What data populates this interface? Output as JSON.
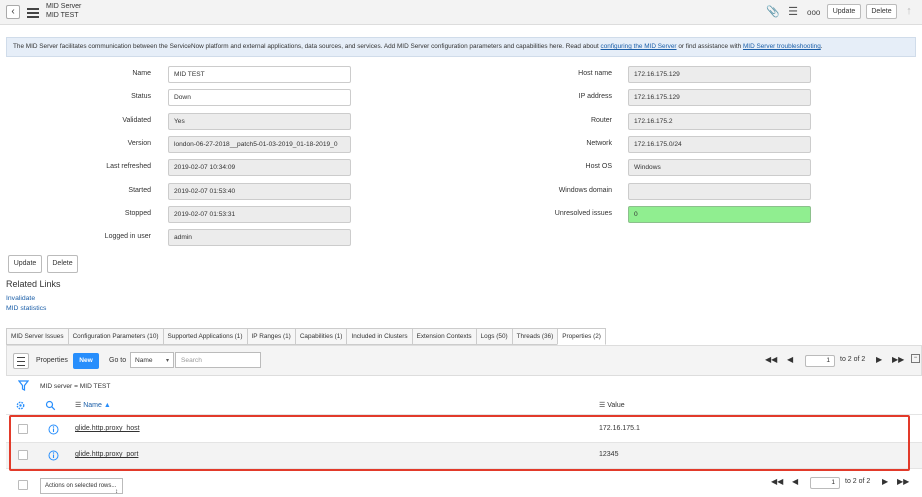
{
  "header": {
    "title": "MID Server",
    "subtitle": "MID TEST",
    "update_label": "Update",
    "delete_label": "Delete",
    "more_label": "ooo"
  },
  "info": {
    "text_before": "The MID Server facilitates communication between the ServiceNow platform and external applications, data sources, and services. Add MID Server configuration parameters and capabilities here. Read about ",
    "link1": "configuring the MID Server",
    "text_middle": " or find assistance with ",
    "link2": "MID Server troubleshooting",
    "text_after": "."
  },
  "form_left": [
    {
      "label": "Name",
      "value": "MID TEST",
      "style": "wr"
    },
    {
      "label": "Status",
      "value": "Down",
      "style": "wr"
    },
    {
      "label": "Validated",
      "value": "Yes",
      "style": "ro"
    },
    {
      "label": "Version",
      "value": "london-06-27-2018__patch5-01-03-2019_01-18-2019_0",
      "style": "ro"
    },
    {
      "label": "Last refreshed",
      "value": "2019-02-07 10:34:09",
      "style": "ro"
    },
    {
      "label": "Started",
      "value": "2019-02-07 01:53:40",
      "style": "ro"
    },
    {
      "label": "Stopped",
      "value": "2019-02-07 01:53:31",
      "style": "ro"
    },
    {
      "label": "Logged in user",
      "value": "admin",
      "style": "ro"
    }
  ],
  "form_right": [
    {
      "label": "Host name",
      "value": "172.16.175.129",
      "style": "ro"
    },
    {
      "label": "IP address",
      "value": "172.16.175.129",
      "style": "ro"
    },
    {
      "label": "Router",
      "value": "172.16.175.2",
      "style": "ro"
    },
    {
      "label": "Network",
      "value": "172.16.175.0/24",
      "style": "ro"
    },
    {
      "label": "Host OS",
      "value": "Windows",
      "style": "ro"
    },
    {
      "label": "Windows domain",
      "value": "",
      "style": "ro"
    },
    {
      "label": "Unresolved issues",
      "value": "0",
      "style": "ok"
    }
  ],
  "form_buttons": {
    "update": "Update",
    "delete": "Delete"
  },
  "related": {
    "title": "Related Links",
    "links": [
      "Invalidate",
      "MID statistics"
    ]
  },
  "tabs": [
    "MID Server Issues",
    "Configuration Parameters (10)",
    "Supported Applications (1)",
    "IP Ranges (1)",
    "Capabilities (1)",
    "Included in Clusters",
    "Extension Contexts",
    "Logs (50)",
    "Threads (36)",
    "Properties (2)"
  ],
  "active_tab": "Properties (2)",
  "list": {
    "title": "Properties",
    "new_label": "New",
    "goto_label": "Go to",
    "goto_field": "Name",
    "search_placeholder": "Search",
    "page_value": "1",
    "page_total": "to 2 of 2",
    "page_total_bottom": "to 2 of 2",
    "filter_text": "MID server = MID TEST",
    "col_name": "Name",
    "col_value": "Value",
    "rows": [
      {
        "name": "glide.http.proxy_host",
        "value": "172.16.175.1"
      },
      {
        "name": "glide.http.proxy_port",
        "value": "12345"
      }
    ],
    "actions_label": "Actions on selected rows..."
  },
  "colors": {
    "accent": "#278efc",
    "link": "#1a5ea8",
    "highlight": "#e23a2a",
    "ok": "#90ee90"
  },
  "icons": [
    "back-icon",
    "menu-icon",
    "attachment-icon",
    "settings-sliders-icon",
    "more-icon",
    "up-arrow-icon",
    "filter-icon",
    "gear-icon",
    "search-icon",
    "info-icon",
    "first-page-icon",
    "prev-page-icon",
    "next-page-icon",
    "last-page-icon",
    "collapse-icon",
    "sort-asc-icon"
  ]
}
